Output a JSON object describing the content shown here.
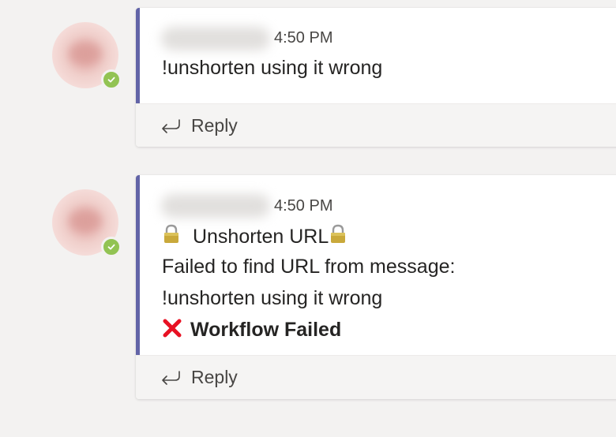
{
  "messages": [
    {
      "timestamp": "4:50 PM",
      "body": "!unshorten using it wrong",
      "reply_label": "Reply",
      "presence": "available"
    },
    {
      "timestamp": "4:50 PM",
      "title": "Unshorten URL",
      "line_1": "Failed to find URL from message:",
      "line_2": "!unshorten using it wrong",
      "status": "Workflow Failed",
      "reply_label": "Reply",
      "presence": "available"
    }
  ],
  "colors": {
    "accent": "#6264a7",
    "presence_available": "#92c353",
    "error": "#e81123"
  },
  "icons": {
    "title_prefix": "lock-icon",
    "title_suffix": "lock-icon",
    "status": "cross-mark-icon",
    "reply": "reply-arrow-icon"
  }
}
